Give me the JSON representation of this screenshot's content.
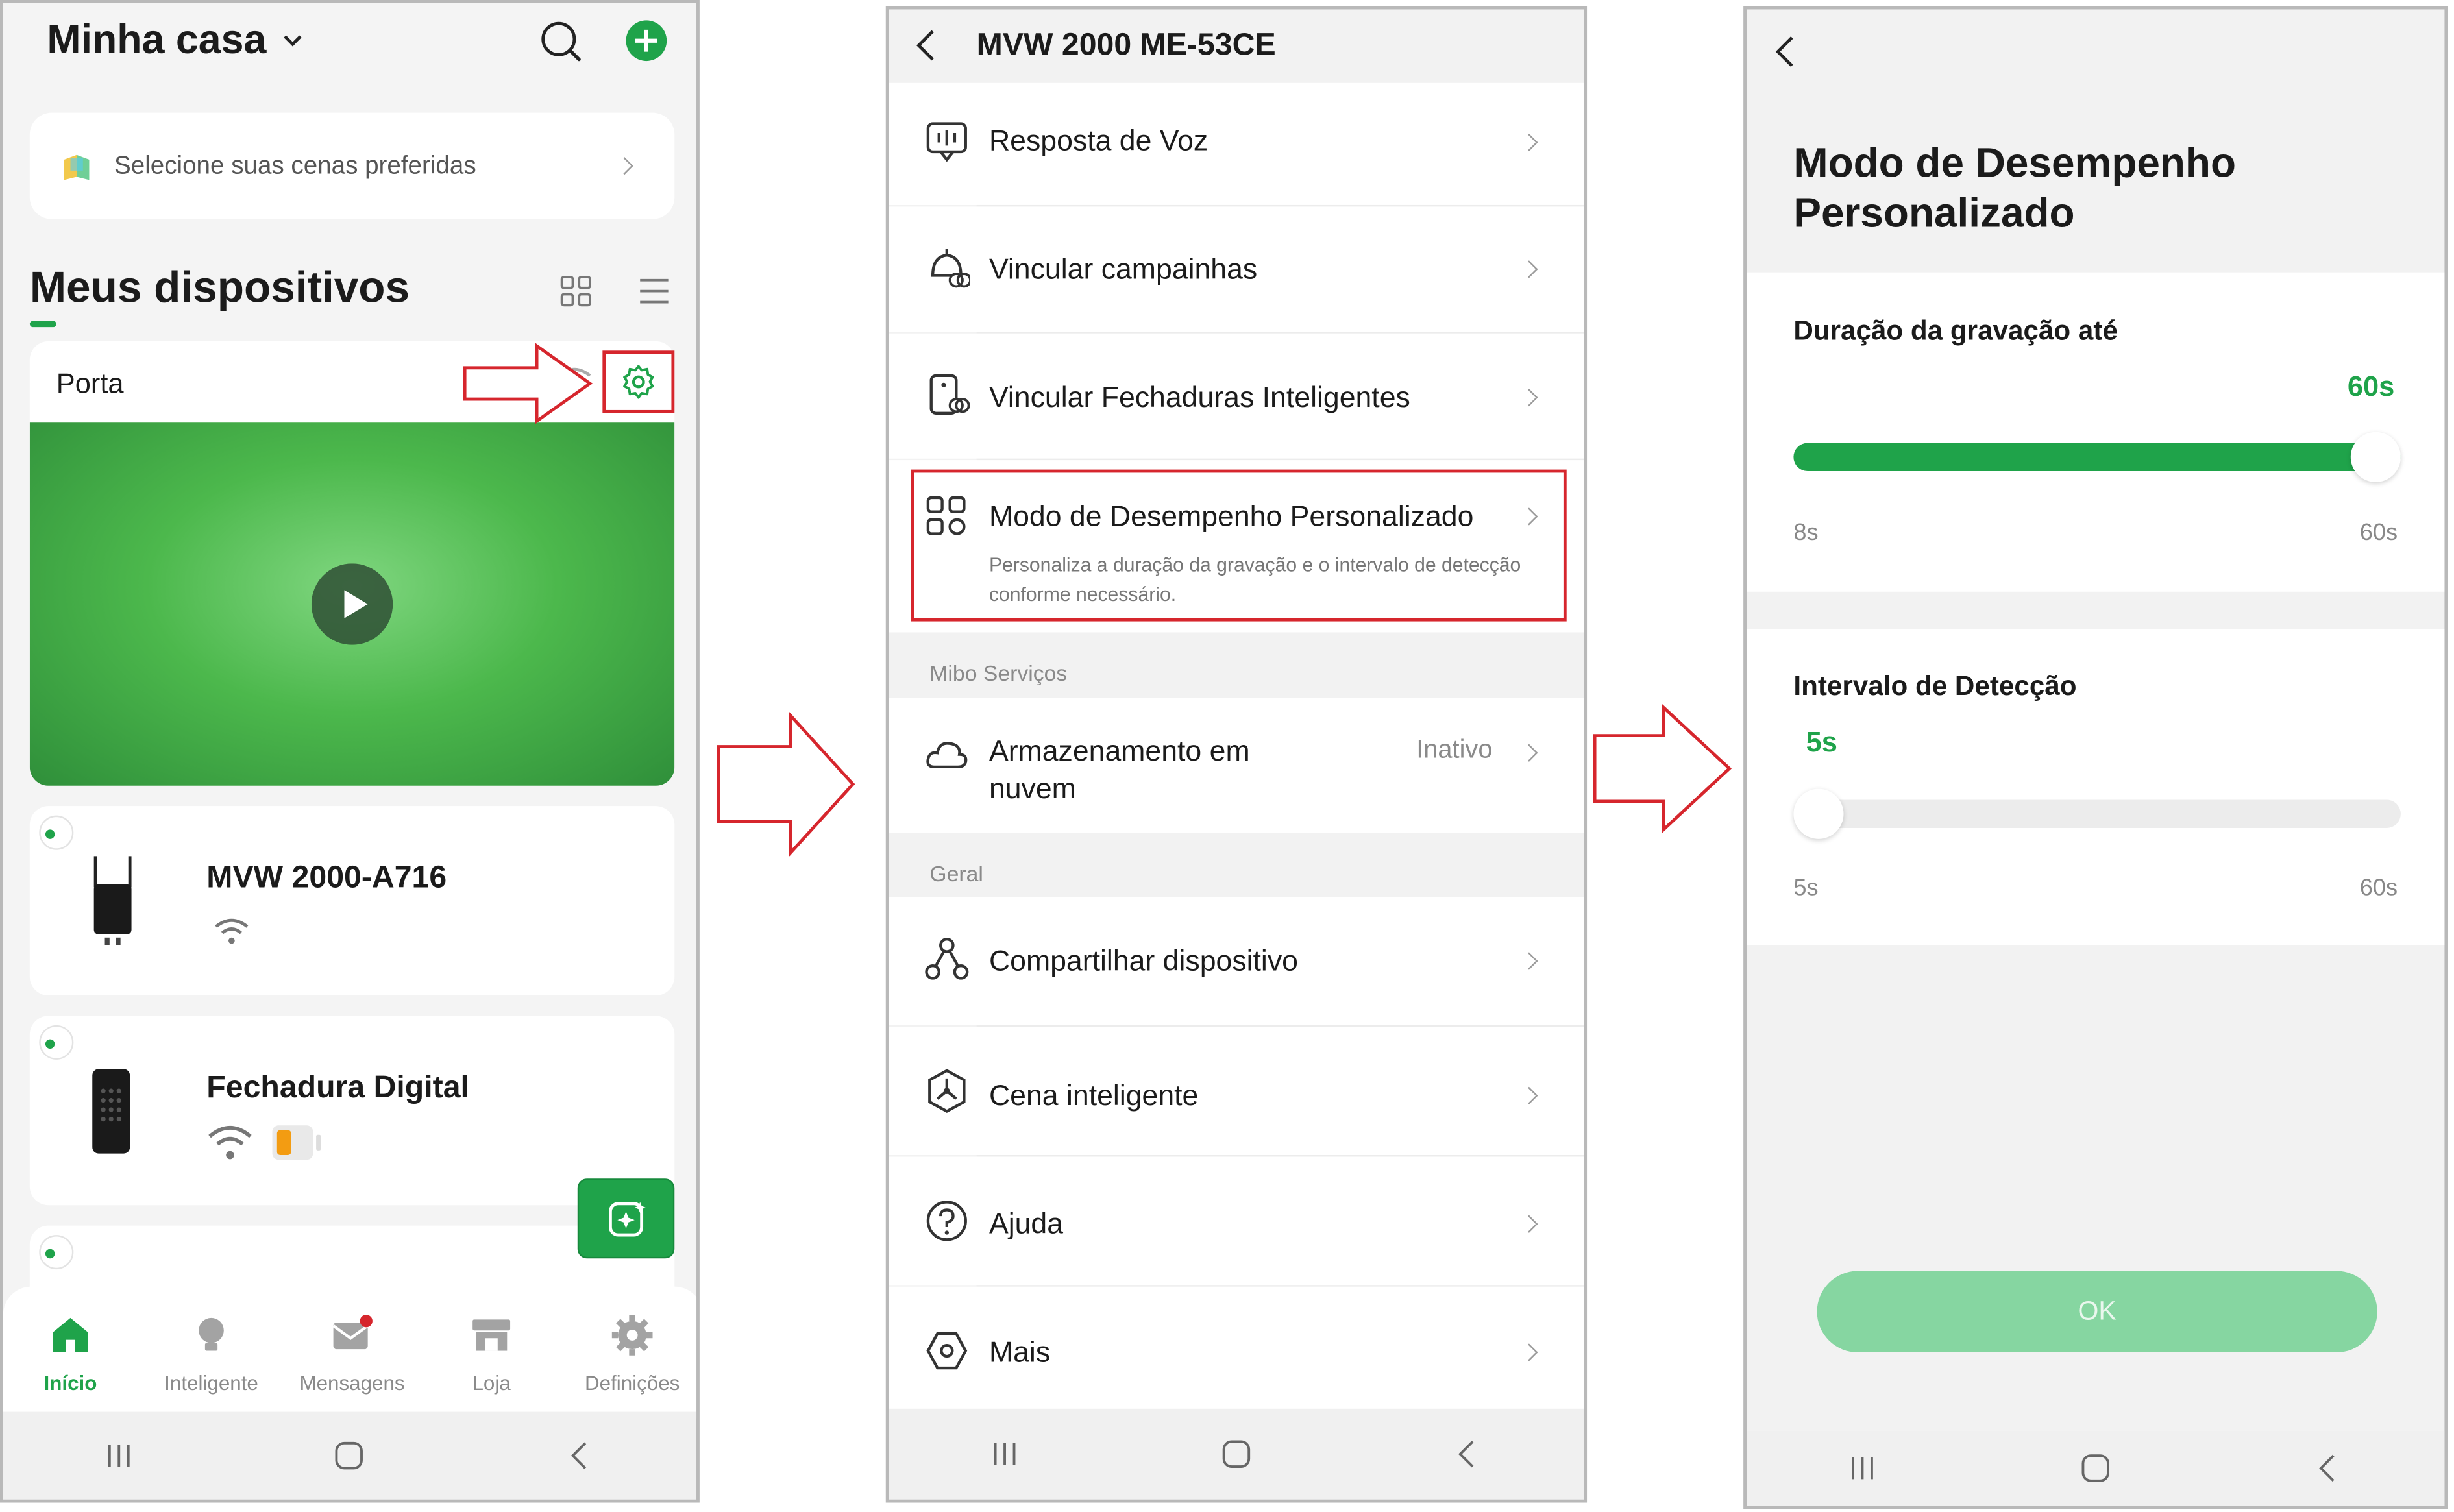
{
  "colors": {
    "accent": "#1fa34a",
    "highlight_red": "#d6262d",
    "ok_disabled": "#86d6a1"
  },
  "screen1": {
    "home_title": "Minha casa",
    "scenes_banner": "Selecione suas cenas preferidas",
    "devices_heading": "Meus dispositivos",
    "camera_card": {
      "name": "Porta",
      "settings_icon": "gear-icon"
    },
    "devices": [
      {
        "name": "MVW 2000-A716"
      },
      {
        "name": "Fechadura Digital"
      }
    ],
    "tabs": [
      {
        "label": "Início",
        "icon": "home-icon"
      },
      {
        "label": "Inteligente",
        "icon": "bulb-icon"
      },
      {
        "label": "Mensagens",
        "icon": "mail-icon"
      },
      {
        "label": "Loja",
        "icon": "store-icon"
      },
      {
        "label": "Definições",
        "icon": "gear-icon"
      }
    ]
  },
  "screen2": {
    "title": "MVW 2000 ME-53CE",
    "items": [
      {
        "label": "Resposta de Voz",
        "icon": "voice-response-icon"
      },
      {
        "label": "Vincular campainhas",
        "icon": "doorbell-link-icon"
      },
      {
        "label": "Vincular Fechaduras Inteligentes",
        "icon": "lock-link-icon"
      },
      {
        "label": "Modo de Desempenho Personalizado",
        "icon": "performance-mode-icon",
        "description": "Personaliza a duração da gravação e o intervalo de detecção conforme necessário."
      }
    ],
    "section_services": "Mibo Serviços",
    "cloud": {
      "label": "Armazenamento em nuvem",
      "value": "Inativo",
      "icon": "cloud-icon"
    },
    "section_general": "Geral",
    "general_items": [
      {
        "label": "Compartilhar dispositivo",
        "icon": "share-icon"
      },
      {
        "label": "Cena inteligente",
        "icon": "smart-scene-icon"
      },
      {
        "label": "Ajuda",
        "icon": "help-icon"
      },
      {
        "label": "Mais",
        "icon": "more-icon"
      }
    ]
  },
  "screen3": {
    "title_line1": "Modo de Desempenho",
    "title_line2": "Personalizado",
    "recording": {
      "label": "Duração da gravação até",
      "value": "60s",
      "min": "8s",
      "max": "60s",
      "fraction": 1.0
    },
    "detection": {
      "label": "Intervalo de Detecção",
      "value": "5s",
      "min": "5s",
      "max": "60s",
      "fraction": 0.0
    },
    "ok_button": "OK"
  }
}
